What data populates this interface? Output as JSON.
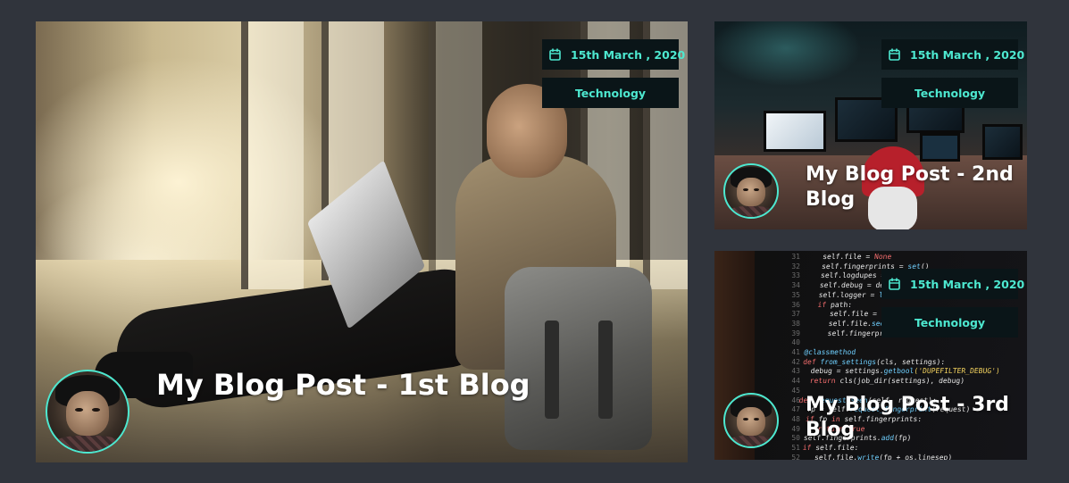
{
  "theme": {
    "accent": "#4de8d0",
    "badge_background": "#0a1518",
    "page_background": "#30343c"
  },
  "posts": [
    {
      "title": "My Blog Post - 1st Blog",
      "date": "15th March , 2020",
      "category": "Technology",
      "date_icon": "calendar-icon",
      "image": "man-with-laptop-photo"
    },
    {
      "title": "My Blog Post - 2nd Blog",
      "date": "15th March , 2020",
      "category": "Technology",
      "date_icon": "calendar-icon",
      "image": "hackers-room-photo"
    },
    {
      "title": "My Blog Post - 3rd Blog",
      "date": "15th March , 2020",
      "category": "Technology",
      "date_icon": "calendar-icon",
      "image": "python-code-photo"
    }
  ]
}
